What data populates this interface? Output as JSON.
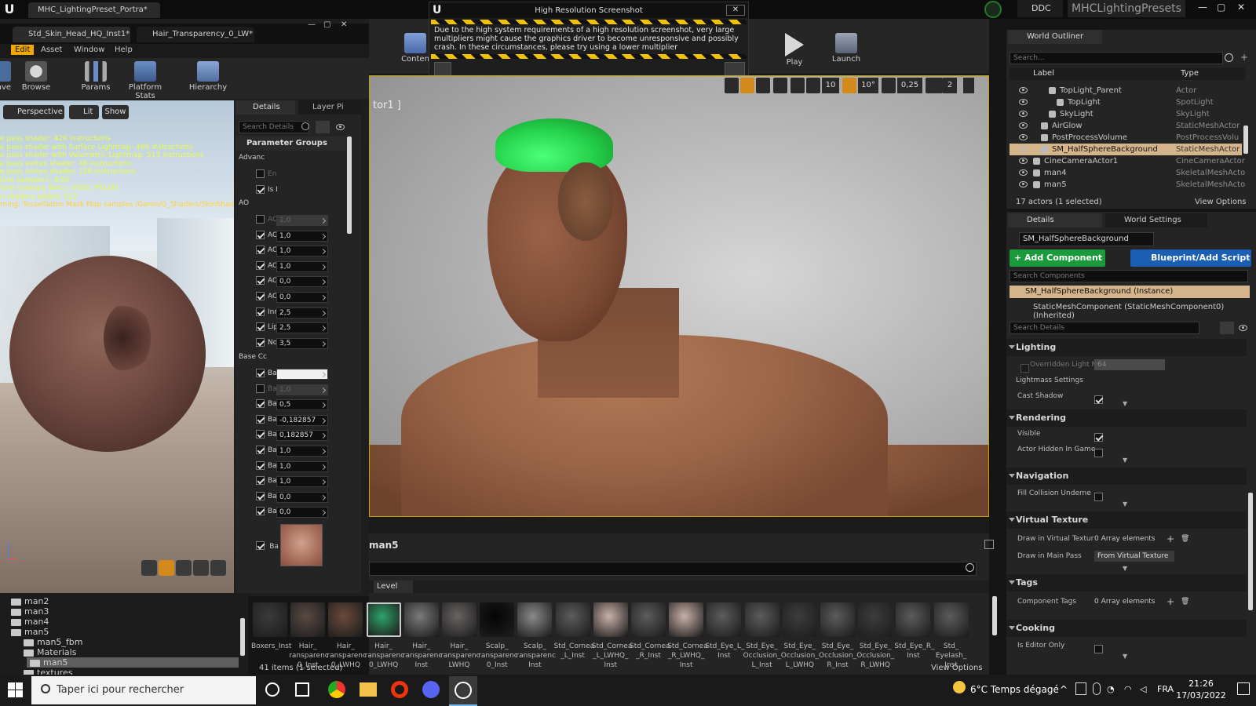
{
  "window": {
    "tab_title": "MHC_LightingPreset_Portra*",
    "project": "MHCLightingPresets",
    "ddc": "DDC"
  },
  "editor_tabs": [
    "Std_Skin_Head_HQ_Inst1*",
    "Hair_Transparency_0_LW*"
  ],
  "menu": [
    "Edit",
    "Asset",
    "Window",
    "Help"
  ],
  "toolbar": {
    "save": "ave",
    "browse": "Browse",
    "params": "Params",
    "platform_stats": "Platform Stats",
    "hierarchy": "Hierarchy"
  },
  "level_toolbar": {
    "content": "Conten",
    "play": "Play",
    "launch": "Launch"
  },
  "viewport_small": {
    "perspective": "Perspective",
    "lit": "Lit",
    "show": "Show",
    "stats": [
      "e pass shader: 426 instructions",
      "e pass shader with Surface Lightmap: 466 instructions",
      "e pass shader with Volumetric Lightmap: 513 instructions",
      "e pass vertex shader: 46 instructions",
      "e pass vertex shader: 158 instructions",
      "ture samplers: 4/16",
      "ture Lookups (Est.): VS(0), PS(18)",
      "n shaders added: 522"
    ],
    "warning": "rning: Tessellation Mask Map samples /Game/Q_Shaders/SkinShader/T"
  },
  "details_tabs": {
    "details": "Details",
    "layer": "Layer Pi"
  },
  "details_search": "Search Details",
  "param_groups": {
    "header": "Parameter Groups",
    "advanced": "Advanc",
    "ao": "AO",
    "base": "Base Cc",
    "adv_rows": [
      {
        "label": "En",
        "on": false
      },
      {
        "label": "Is I",
        "on": true
      }
    ],
    "ao_rows": [
      {
        "label": "AO",
        "value": "1,0",
        "on": false
      },
      {
        "label": "AO",
        "value": "1,0",
        "on": true
      },
      {
        "label": "AO",
        "value": "1,0",
        "on": true
      },
      {
        "label": "AO",
        "value": "1,0",
        "on": true
      },
      {
        "label": "AO",
        "value": "0,0",
        "on": true
      },
      {
        "label": "AO",
        "value": "0,0",
        "on": true
      },
      {
        "label": "Inn",
        "value": "2,5",
        "on": true
      },
      {
        "label": "Lip",
        "value": "2,5",
        "on": true
      },
      {
        "label": "No",
        "value": "3,5",
        "on": true
      }
    ],
    "base_rows": [
      {
        "label": "Ba",
        "value": "",
        "on": true
      },
      {
        "label": "Ba",
        "value": "1,0",
        "on": false
      },
      {
        "label": "Ba",
        "value": "0,5",
        "on": true
      },
      {
        "label": "Ba",
        "value": "-0,182857",
        "on": true
      },
      {
        "label": "Ba",
        "value": "0,182857",
        "on": true
      },
      {
        "label": "Ba",
        "value": "1,0",
        "on": true
      },
      {
        "label": "Ba",
        "value": "1,0",
        "on": true
      },
      {
        "label": "Ba",
        "value": "1,0",
        "on": true
      },
      {
        "label": "Ba",
        "value": "0,0",
        "on": true
      },
      {
        "label": "Ba",
        "value": "0,0",
        "on": true
      }
    ],
    "texture_label": "Ba"
  },
  "dialog": {
    "title": "High Resolution Screenshot",
    "text": "Due to the high system requirements of a high resolution screenshot, very large multipliers might cause the graphics driver to become unresponsive and possibly crash. In these circumstances, please try using a lower multiplier"
  },
  "viewport_main": {
    "label": "tor1 ]",
    "grid": "10",
    "angle": "10°",
    "scale": "0,25",
    "cams": "2"
  },
  "content_browser": {
    "path": "man5",
    "level": "Level",
    "folders": [
      "man2",
      "man3",
      "man4",
      "man5",
      "man5_fbm",
      "Materials",
      "man5",
      "textures"
    ],
    "items_count": "41 items (1 selected)",
    "view_options": "View Options",
    "assets": [
      {
        "name": "Boxers_Inst",
        "color": "#3a3a3a"
      },
      {
        "name": "Hair_ ransparenc 0_Inst",
        "color": "#5a4a44"
      },
      {
        "name": "Hair_ ransparenc 0_LWHQ",
        "color": "#6a4a3a"
      },
      {
        "name": "Hair_ ransparenc 0_LWHQ",
        "color": "#2ea36a"
      },
      {
        "name": "Hair_ ransparenc Inst",
        "color": "#7a7a7a"
      },
      {
        "name": "Hair_ ransparenc LWHQ",
        "color": "#6a6464"
      },
      {
        "name": "Scalp_ ransparenc 0_Inst",
        "color": "#050505"
      },
      {
        "name": "Scalp_ ransparenc Inst",
        "color": "#8a8a8a"
      },
      {
        "name": "Std_Cornea _L_Inst",
        "color": "#5c5c5c"
      },
      {
        "name": "Std_Cornea _L_LWHQ_ Inst",
        "color": "#c9b0a8"
      },
      {
        "name": "Std_Cornea _R_Inst",
        "color": "#5c5c5c"
      },
      {
        "name": "Std_Cornea _R_LWHQ_ Inst",
        "color": "#c9b0a8"
      },
      {
        "name": "Std_Eye_L_ Inst",
        "color": "#5c5c5c"
      },
      {
        "name": "Std_Eye_ Occlusion_ L_Inst",
        "color": "#5c5c5c"
      },
      {
        "name": "Std_Eye_ Occlusion_ L_LWHQ",
        "color": "#3c3c3c"
      },
      {
        "name": "Std_Eye_ Occlusion_ R_Inst",
        "color": "#5c5c5c"
      },
      {
        "name": "Std_Eye_ Occlusion_ R_LWHQ",
        "color": "#3c3c3c"
      },
      {
        "name": "Std_Eye_R_ Inst",
        "color": "#5c5c5c"
      },
      {
        "name": "Std_ Eyelash_ Inst",
        "color": "#5c5c5c"
      }
    ]
  },
  "outliner": {
    "title": "World Outliner",
    "search": "Search...",
    "col_label": "Label",
    "col_type": "Type",
    "rows": [
      {
        "label": "TopLight_Parent",
        "type": "Actor",
        "indent": 3,
        "selected": false
      },
      {
        "label": "TopLight",
        "type": "SpotLight",
        "indent": 4,
        "selected": false
      },
      {
        "label": "SkyLight",
        "type": "SkyLight",
        "indent": 3,
        "selected": false
      },
      {
        "label": "AirGlow",
        "type": "StaticMeshActor",
        "indent": 2,
        "selected": false
      },
      {
        "label": "PostProcessVolume",
        "type": "PostProcessVolu",
        "indent": 2,
        "selected": false
      },
      {
        "label": "SM_HalfSphereBackground",
        "type": "StaticMeshActor",
        "indent": 2,
        "selected": true
      },
      {
        "label": "CineCameraActor1",
        "type": "CineCameraActor",
        "indent": 1,
        "selected": false
      },
      {
        "label": "man4",
        "type": "SkeletalMeshActo",
        "indent": 1,
        "selected": false
      },
      {
        "label": "man5",
        "type": "SkeletalMeshActo",
        "indent": 1,
        "selected": false
      }
    ],
    "count": "17 actors (1 selected)",
    "view_options": "View Options"
  },
  "details_right": {
    "tab_details": "Details",
    "tab_world": "World Settings",
    "actor_name": "SM_HalfSphereBackground",
    "add_component": "+ Add Component",
    "blueprint": "Blueprint/Add Script",
    "search_components": "Search Components",
    "instance": "SM_HalfSphereBackground (Instance)",
    "component": "StaticMeshComponent (StaticMeshComponent0) (Inherited)",
    "search_details": "Search Details",
    "lighting": "Lighting",
    "overridden": "Overridden Light M",
    "overridden_val": "64",
    "lightmass": "Lightmass Settings",
    "cast_shadow": "Cast Shadow",
    "rendering": "Rendering",
    "visible": "Visible",
    "hidden": "Actor Hidden In Game",
    "navigation": "Navigation",
    "fill_collision": "Fill Collision Underne",
    "virtual_texture": "Virtual Texture",
    "draw_vt": "Draw in Virtual Textur",
    "draw_vt_val": "0 Array elements",
    "draw_main": "Draw in Main Pass",
    "draw_main_val": "From Virtual Texture",
    "tags": "Tags",
    "component_tags": "Component Tags",
    "tags_val": "0 Array elements",
    "cooking": "Cooking",
    "editor_only": "Is Editor Only"
  },
  "taskbar": {
    "search": "Taper ici pour rechercher",
    "weather": "6°C Temps dégagé",
    "lang": "FRA",
    "time": "21:26",
    "date": "17/03/2022"
  }
}
